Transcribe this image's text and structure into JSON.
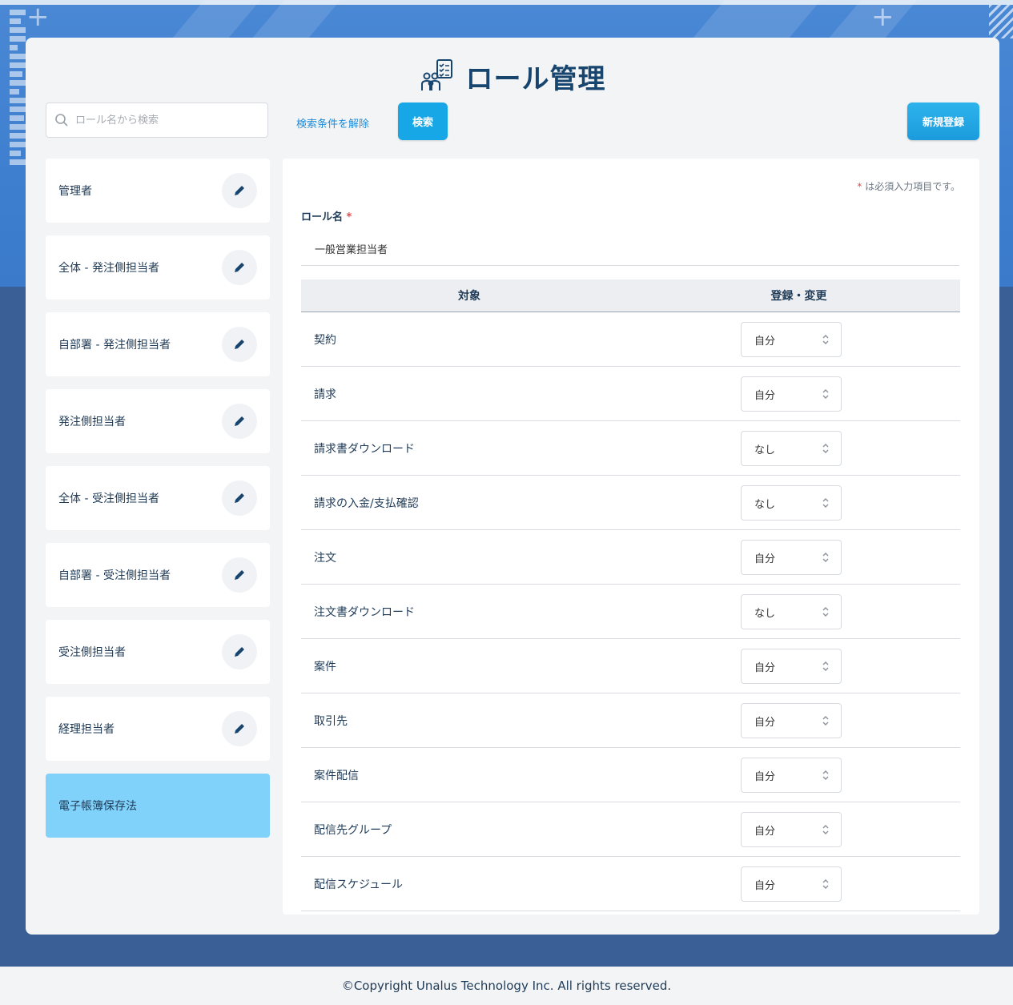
{
  "header": {
    "title": "ロール管理"
  },
  "search": {
    "placeholder": "ロール名から検索",
    "clear_label": "検索条件を解除",
    "search_button": "検索",
    "new_button": "新規登録"
  },
  "roles": [
    {
      "name": "管理者"
    },
    {
      "name": "全体 - 発注側担当者"
    },
    {
      "name": "自部署 - 発注側担当者"
    },
    {
      "name": "発注側担当者"
    },
    {
      "name": "全体 - 受注側担当者"
    },
    {
      "name": "自部署 - 受注側担当者"
    },
    {
      "name": "受注側担当者"
    },
    {
      "name": "経理担当者"
    },
    {
      "name": "電子帳簿保存法",
      "selected": true
    }
  ],
  "form": {
    "required_mark": "*",
    "required_note": "は必須入力項目です。",
    "role_name_label": "ロール名",
    "role_name_value": "一般営業担当者"
  },
  "table": {
    "headers": [
      "対象",
      "登録・変更"
    ],
    "rows": [
      {
        "target": "契約",
        "value": "自分"
      },
      {
        "target": "請求",
        "value": "自分"
      },
      {
        "target": "請求書ダウンロード",
        "value": "なし"
      },
      {
        "target": "請求の入金/支払確認",
        "value": "なし"
      },
      {
        "target": "注文",
        "value": "自分"
      },
      {
        "target": "注文書ダウンロード",
        "value": "なし"
      },
      {
        "target": "案件",
        "value": "自分"
      },
      {
        "target": "取引先",
        "value": "自分"
      },
      {
        "target": "案件配信",
        "value": "自分"
      },
      {
        "target": "配信先グループ",
        "value": "自分"
      },
      {
        "target": "配信スケジュール",
        "value": "自分"
      }
    ]
  },
  "footer": {
    "copyright": "©Copyright Unalus Technology Inc. All rights reserved."
  },
  "colors": {
    "accent": "#17a7e6",
    "selected_role": "#80d2fb",
    "title": "#17456e",
    "background": "#3a5f96"
  }
}
